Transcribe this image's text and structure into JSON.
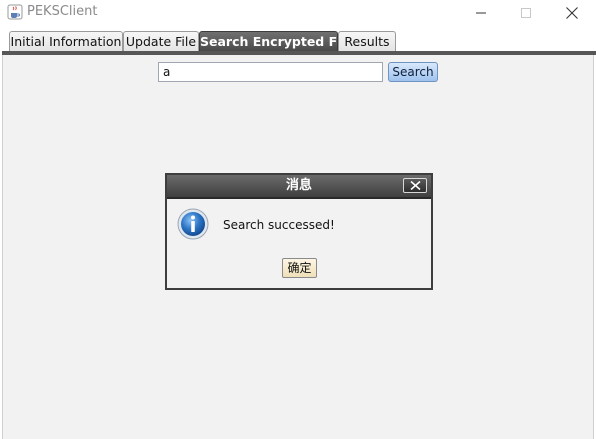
{
  "window": {
    "title": "PEKSClient",
    "app_icon": "java-cup-icon",
    "controls": [
      "minimize-icon",
      "maximize-icon",
      "close-icon"
    ]
  },
  "tabs": [
    {
      "label": "Initial Information",
      "active": false
    },
    {
      "label": "Update File",
      "active": false
    },
    {
      "label": "Search Encrypted File",
      "active": true
    },
    {
      "label": "Results",
      "active": false
    }
  ],
  "search": {
    "value": "a",
    "button_label": "Search"
  },
  "dialog": {
    "title": "消息",
    "icon": "info-icon",
    "message": "Search successed!",
    "ok_label": "确定"
  },
  "colors": {
    "active_tab": "#575757",
    "search_button": "#9fc2ee",
    "panel_background": "#f2f2f2"
  }
}
